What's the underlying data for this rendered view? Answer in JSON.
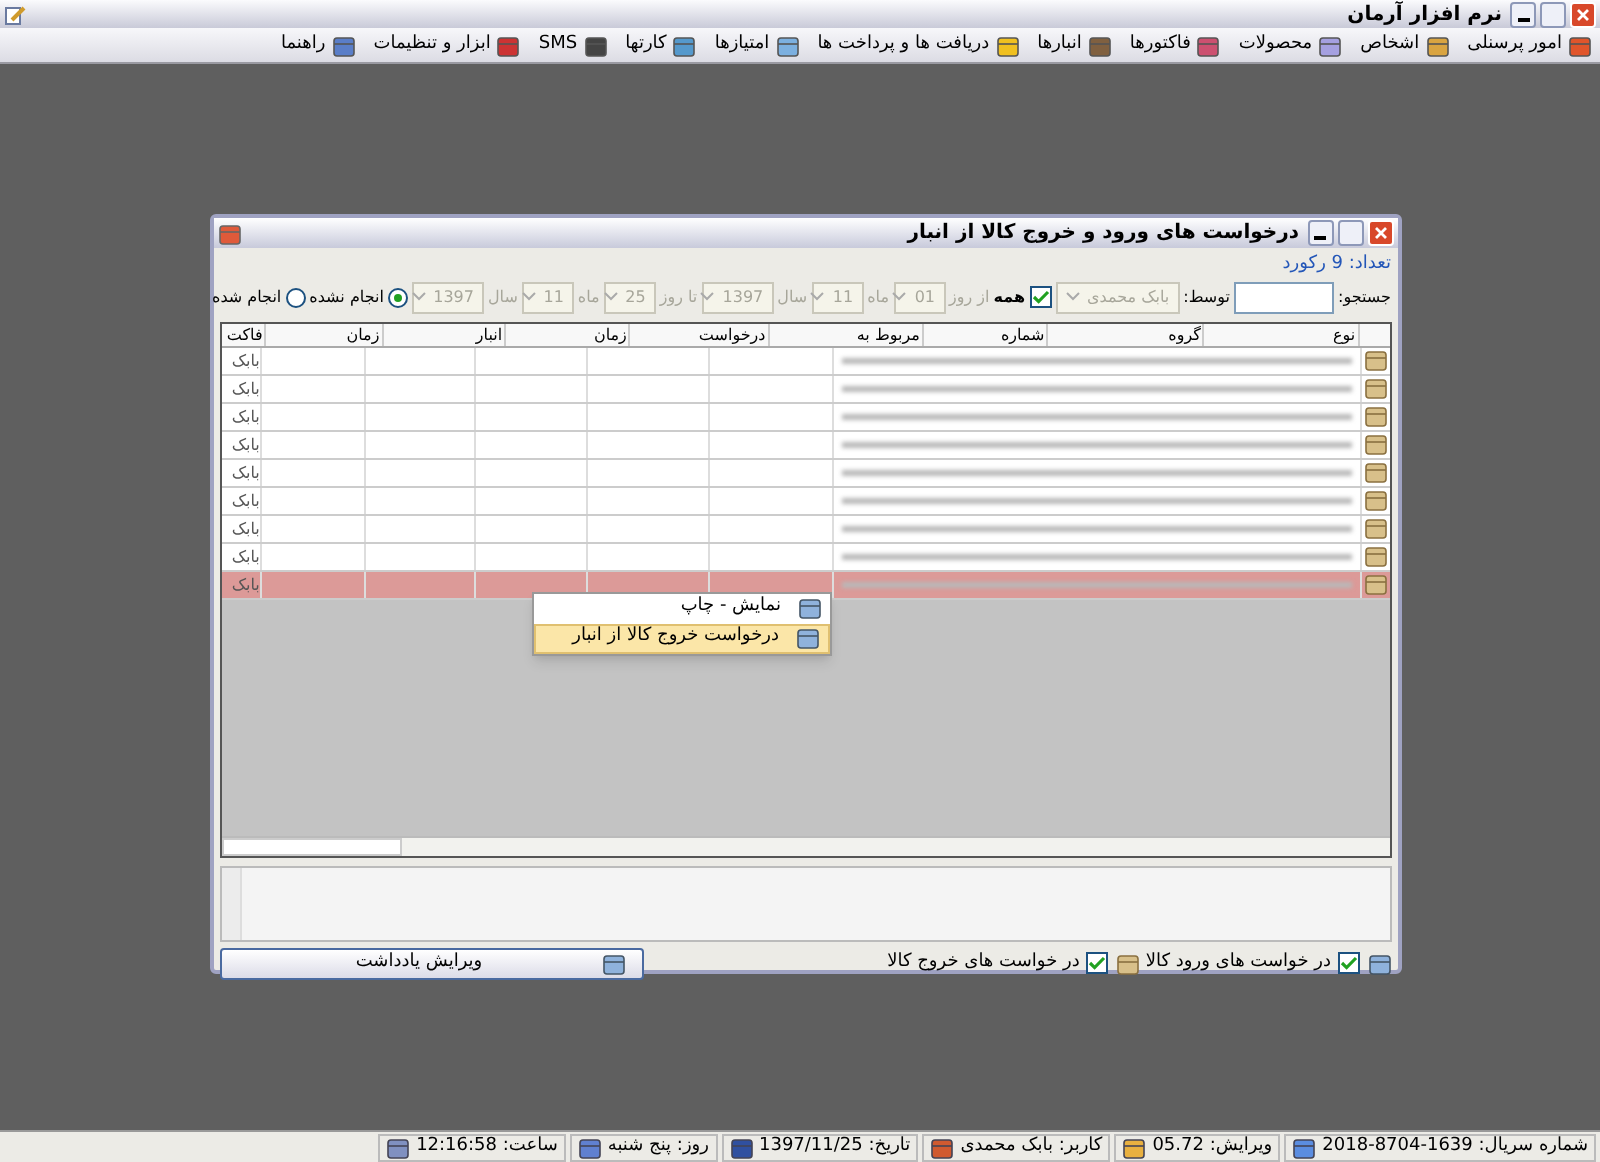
{
  "window": {
    "title": "نرم افزار آرمان"
  },
  "menu": [
    {
      "label": "امور پرسنلی"
    },
    {
      "label": "اشخاص"
    },
    {
      "label": "محصولات"
    },
    {
      "label": "فاکتورها"
    },
    {
      "label": "انبارها"
    },
    {
      "label": "دریافت ها و پرداخت ها"
    },
    {
      "label": "امتیازها"
    },
    {
      "label": "کارتها"
    },
    {
      "label": "SMS"
    },
    {
      "label": "ابزار و تنظیمات"
    },
    {
      "label": "راهنما"
    }
  ],
  "dialog": {
    "title": "درخواست های ورود و خروج کالا از انبار",
    "count": "تعداد: 9 رکورد",
    "filter": {
      "search_label": "جستجو:",
      "by_label": "توسط:",
      "by_value": "بابک محمدی",
      "all": {
        "label": "همه",
        "checked": true
      },
      "from_day_label": "از روز",
      "from_day": "01",
      "from_month_label": "ماه",
      "from_month": "11",
      "from_year_label": "سال",
      "from_year": "1397",
      "to_day_label": "تا روز",
      "to_day": "25",
      "to_month_label": "ماه",
      "to_month": "11",
      "to_year_label": "سال",
      "to_year": "1397",
      "status": [
        {
          "label": "انجام نشده",
          "selected": true
        },
        {
          "label": "انجام شده",
          "selected": false
        }
      ]
    },
    "table": {
      "columns": [
        "نوع",
        "گروه",
        "شماره",
        "مربوط به",
        "درخواست",
        "زمان",
        "انبار",
        "زمان",
        "فاکت"
      ],
      "rows": [
        {
          "selected": false,
          "column_10": "بابک"
        },
        {
          "selected": false,
          "column_10": "بابک"
        },
        {
          "selected": false,
          "column_10": "بابک"
        },
        {
          "selected": false,
          "column_10": "بابک"
        },
        {
          "selected": false,
          "column_10": "بابک"
        },
        {
          "selected": false,
          "column_10": "بابک"
        },
        {
          "selected": false,
          "column_10": "بابک"
        },
        {
          "selected": false,
          "column_10": "بابک"
        },
        {
          "selected": true,
          "column_10": "بابک"
        }
      ]
    },
    "context_menu": [
      {
        "label": "نمایش - چاپ",
        "selected": false
      },
      {
        "label": "درخواست خروج کالا از انبار",
        "selected": true
      }
    ],
    "options": [
      {
        "label": "در خواست های ورود کالا",
        "checked": true
      },
      {
        "label": "در خواست های خروج کالا",
        "checked": true
      }
    ],
    "edit_note_button": "ویرایش یادداشت"
  },
  "status_bar": [
    {
      "text": "شماره سریال: 1639-8704-2018"
    },
    {
      "text": "ویرایش: 05.72"
    },
    {
      "text": "کاربر: بابک محمدی"
    },
    {
      "text": "تاریخ: 1397/11/25"
    },
    {
      "text": "روز: پنج شنبه"
    },
    {
      "text": "ساعت: 12:16:58"
    }
  ]
}
